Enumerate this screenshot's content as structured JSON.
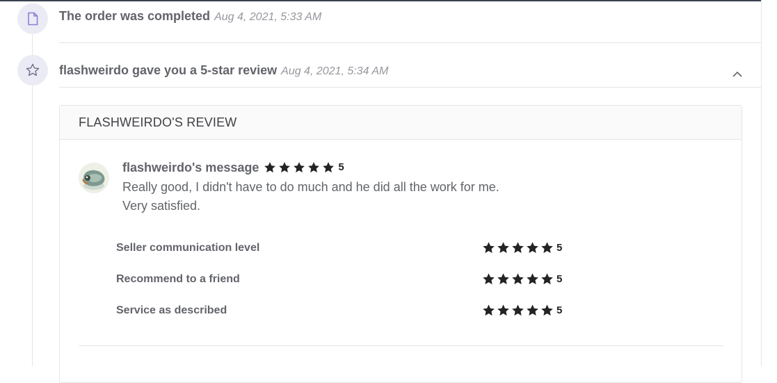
{
  "timeline": {
    "events": [
      {
        "title": "The order was completed",
        "time": "Aug 4, 2021, 5:33 AM",
        "icon": "document-icon"
      },
      {
        "title": "flashweirdo gave you a 5-star review",
        "time": "Aug 4, 2021, 5:34 AM",
        "icon": "star-outline-icon"
      }
    ]
  },
  "review": {
    "header": "FLASHWEIRDO'S REVIEW",
    "message_title": "flashweirdo's message",
    "rating": "5",
    "message_lines": [
      "Really good, I didn't have to do much and he did all the work for me.",
      "Very satisfied."
    ],
    "criteria": [
      {
        "label": "Seller communication level",
        "rating": "5"
      },
      {
        "label": "Recommend to a friend",
        "rating": "5"
      },
      {
        "label": "Service as described",
        "rating": "5"
      }
    ]
  },
  "colors": {
    "star": "#222325",
    "icon_bg": "#ebebf6",
    "icon_accent": "#8b7fd6",
    "text": "#62646a",
    "muted": "#95979d",
    "border": "#e4e5e7"
  }
}
